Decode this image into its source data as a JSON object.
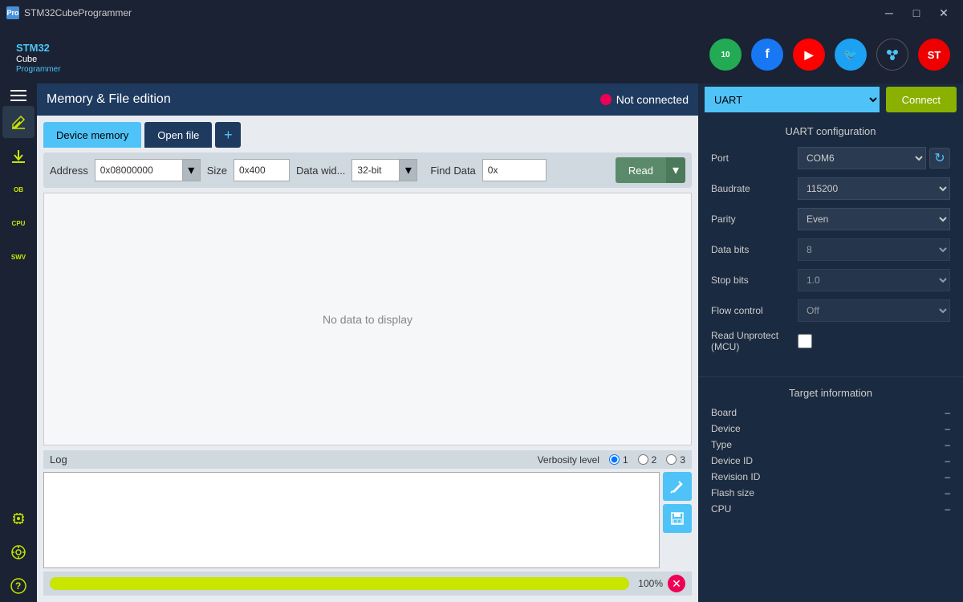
{
  "titlebar": {
    "icon_label": "Pro",
    "title": "STM32CubeProgrammer",
    "min_btn": "─",
    "max_btn": "□",
    "close_btn": "✕"
  },
  "header": {
    "logo_stm": "STM32",
    "logo_cube": "Cube",
    "logo_prog": "Programmer",
    "icon_10y": "10",
    "icon_fb": "f",
    "icon_yt": "▶",
    "icon_tw": "🐦",
    "icon_st": "✦",
    "icon_stlogo": "ST"
  },
  "sidebar": {
    "items": [
      {
        "id": "edit",
        "icon": "✏",
        "label": ""
      },
      {
        "id": "download",
        "icon": "⬇",
        "label": ""
      },
      {
        "id": "ob",
        "label": "OB"
      },
      {
        "id": "cpu",
        "label": "CPU"
      },
      {
        "id": "swv",
        "label": "SWV"
      },
      {
        "id": "ext1",
        "icon": "⊕",
        "label": ""
      },
      {
        "id": "ext2",
        "icon": "◎",
        "label": ""
      },
      {
        "id": "ext3",
        "icon": "✒",
        "label": ""
      },
      {
        "id": "help",
        "icon": "?",
        "label": ""
      }
    ]
  },
  "topbar": {
    "title": "Memory & File edition",
    "not_connected": "Not connected"
  },
  "tabs": {
    "device_memory": "Device memory",
    "open_file": "Open file",
    "plus": "+"
  },
  "controls": {
    "address_label": "Address",
    "address_value": "0x08000000",
    "size_label": "Size",
    "size_value": "0x400",
    "data_width_label": "Data wid...",
    "data_width_value": "32-bit",
    "find_data_label": "Find Data",
    "find_data_value": "0x",
    "read_btn": "Read"
  },
  "data_area": {
    "empty_message": "No data to display"
  },
  "log": {
    "title": "Log",
    "verbosity_label": "Verbosity level",
    "verbosity_1": "1",
    "verbosity_2": "2",
    "verbosity_3": "3"
  },
  "progress": {
    "value": 100,
    "label": "100%"
  },
  "right_panel": {
    "interface": "UART",
    "connect_btn": "Connect",
    "uart_config_title": "UART configuration",
    "port_label": "Port",
    "port_value": "COM6",
    "baudrate_label": "Baudrate",
    "baudrate_value": "115200",
    "parity_label": "Parity",
    "parity_value": "Even",
    "data_bits_label": "Data bits",
    "data_bits_value": "8",
    "stop_bits_label": "Stop bits",
    "stop_bits_value": "1.0",
    "flow_control_label": "Flow control",
    "flow_control_value": "Off",
    "read_unprotect_label": "Read Unprotect (MCU)",
    "target_info_title": "Target information",
    "board_label": "Board",
    "board_value": "–",
    "device_label": "Device",
    "device_value": "–",
    "type_label": "Type",
    "type_value": "–",
    "device_id_label": "Device ID",
    "device_id_value": "–",
    "revision_id_label": "Revision ID",
    "revision_id_value": "–",
    "flash_size_label": "Flash size",
    "flash_size_value": "–",
    "cpu_label": "CPU",
    "cpu_value": "–"
  }
}
